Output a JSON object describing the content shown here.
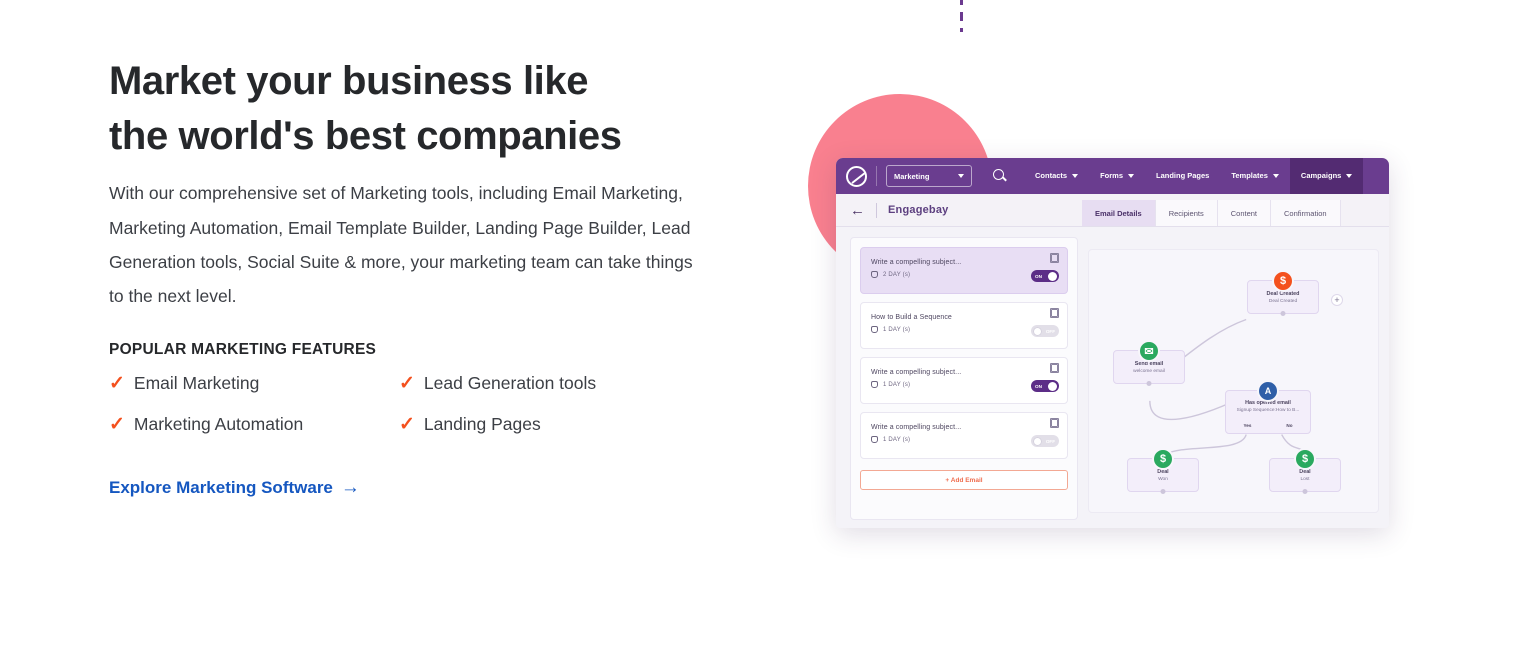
{
  "hero": {
    "headline": "Market your business like\nthe world's best companies",
    "paragraph": "With our comprehensive set of Marketing tools, including Email Marketing, Marketing Automation, Email Template Builder, Landing Page Builder, Lead Generation tools, Social Suite & more, your marketing team can take things to the next level.",
    "features_title": "POPULAR MARKETING FEATURES",
    "features": [
      {
        "label": "Email Marketing"
      },
      {
        "label": "Lead Generation tools"
      },
      {
        "label": "Marketing Automation"
      },
      {
        "label": "Landing Pages"
      }
    ],
    "cta_label": "Explore Marketing Software",
    "cta_arrow": "→"
  },
  "colors": {
    "accent_check": "#f4511e",
    "cta_blue": "#1557c0",
    "brand_purple": "#6a3d8f",
    "decor_pink": "#f9808f"
  },
  "app": {
    "topbar": {
      "module_label": "Marketing",
      "nav": [
        {
          "label": "Contacts",
          "has_caret": true,
          "active": false
        },
        {
          "label": "Forms",
          "has_caret": true,
          "active": false
        },
        {
          "label": "Landing Pages",
          "has_caret": false,
          "active": false
        },
        {
          "label": "Templates",
          "has_caret": true,
          "active": false
        },
        {
          "label": "Campaigns",
          "has_caret": true,
          "active": true
        }
      ]
    },
    "subbar": {
      "back_label": "←",
      "title": "Engagebay",
      "tabs": [
        {
          "label": "Email Details",
          "active": true
        },
        {
          "label": "Recipients",
          "active": false
        },
        {
          "label": "Content",
          "active": false
        },
        {
          "label": "Confirmation",
          "active": false
        }
      ]
    },
    "sequence": {
      "cards": [
        {
          "subject": "Write a compelling subject...",
          "delay": "2 DAY (s)",
          "toggle": "ON",
          "selected": true
        },
        {
          "subject": "How to Build a Sequence",
          "delay": "1 DAY (s)",
          "toggle": "OFF",
          "selected": false
        },
        {
          "subject": "Write a compelling subject...",
          "delay": "1 DAY (s)",
          "toggle": "ON",
          "selected": false
        },
        {
          "subject": "Write a compelling subject...",
          "delay": "1 DAY (s)",
          "toggle": "OFF",
          "selected": false
        }
      ],
      "add_button": "+ Add Email"
    },
    "workflow": {
      "nodes": [
        {
          "id": "deal-created",
          "title": "Deal Created",
          "subtitle": "Deal Created",
          "badge": "$",
          "badge_color": "orange"
        },
        {
          "id": "send-email",
          "title": "Send email",
          "subtitle": "welcome email",
          "badge": "✉",
          "badge_color": "green"
        },
        {
          "id": "has-opened-email",
          "title": "Has opened email",
          "subtitle": "Signup Sequence:How to B...",
          "badge": "A",
          "badge_color": "blue",
          "yes_label": "Yes",
          "no_label": "No"
        },
        {
          "id": "deal-won",
          "title": "Deal",
          "subtitle": "Won",
          "badge": "$",
          "badge_color": "green"
        },
        {
          "id": "deal-lost",
          "title": "Deal",
          "subtitle": "Lost",
          "badge": "$",
          "badge_color": "green"
        }
      ],
      "add_node_label": "+"
    }
  }
}
